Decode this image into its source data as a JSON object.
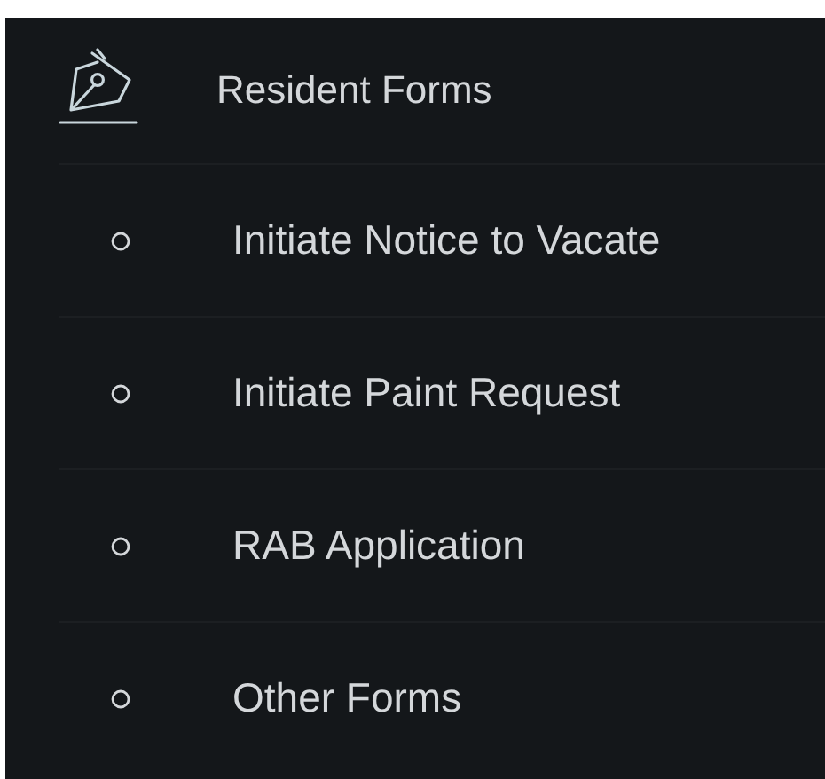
{
  "section": {
    "title": "Resident Forms"
  },
  "items": [
    {
      "label": "Initiate Notice to Vacate"
    },
    {
      "label": "Initiate Paint Request"
    },
    {
      "label": "RAB Application"
    },
    {
      "label": "Other Forms"
    }
  ]
}
